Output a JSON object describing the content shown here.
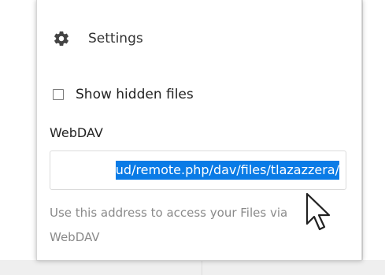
{
  "settings": {
    "label": "Settings",
    "icon": "gear-icon"
  },
  "show_hidden": {
    "label": "Show hidden files",
    "checked": false
  },
  "webdav": {
    "label": "WebDAV",
    "url_visible": "ud/remote.php/dav/files/tlazazzera/",
    "hint": "Use this address to access your Files via WebDAV"
  },
  "colors": {
    "selection": "#0a7be6",
    "hint_text": "#8a8a8a"
  }
}
